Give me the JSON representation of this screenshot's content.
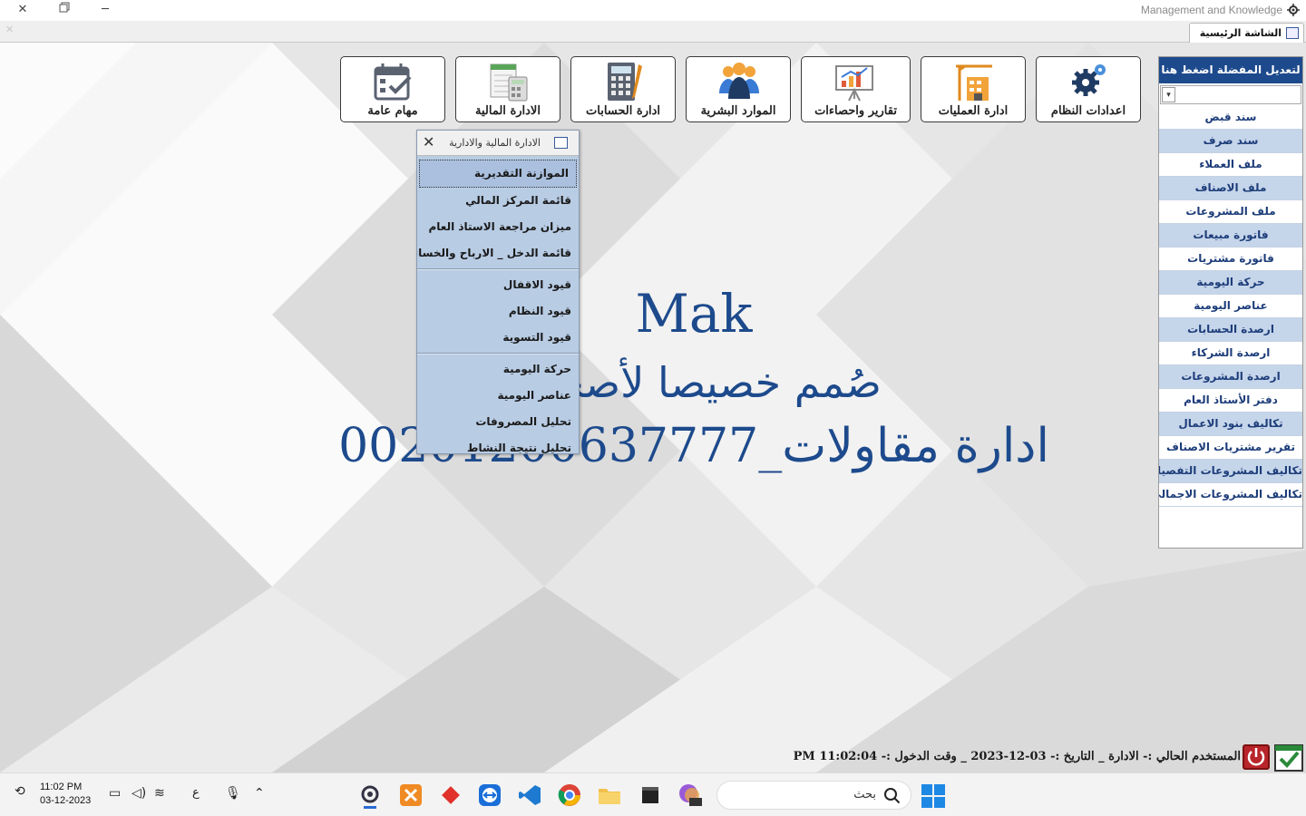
{
  "window": {
    "title": "Management and Knowledge",
    "controls": [
      "close-icon",
      "restore-icon",
      "minimize-icon"
    ]
  },
  "tab": {
    "label": "الشاشة الرئيسية"
  },
  "toolbar": [
    {
      "label": "اعدادات النظام",
      "icon": "gear-icon"
    },
    {
      "label": "ادارة العمليات",
      "icon": "crane-building-icon"
    },
    {
      "label": "تقارير واحصاءات",
      "icon": "presentation-chart-icon"
    },
    {
      "label": "الموارد البشرية",
      "icon": "people-icon"
    },
    {
      "label": "ادارة الحسابات",
      "icon": "calculator-icon"
    },
    {
      "label": "الادارة المالية",
      "icon": "ledger-calculator-icon"
    },
    {
      "label": "مهام عامة",
      "icon": "calendar-check-icon"
    }
  ],
  "favorites": {
    "header": "لتعديل المفضلة اضغط هنا",
    "items": [
      "سند قبض",
      "سند صرف",
      "ملف العملاء",
      "ملف الاصناف",
      "ملف المشروعات",
      "فاتورة مبيعات",
      "فاتورة مشتريات",
      "حركة اليومية",
      "عناصر اليومية",
      "ارصدة الحسابات",
      "ارصدة الشركاء",
      "ارصدة المشروعات",
      "دفتر الأستاذ العام",
      "تكاليف بنود الاعمال",
      "تقرير مشتريات الاصناف",
      "تكاليف المشروعات التفصيلي",
      "تكاليف المشروعات الاجمالي"
    ]
  },
  "center": {
    "line1": "Mak",
    "line2": "صُمم خصيصا لأصحاب",
    "line3": "ادارة مقاولات_00201200637777"
  },
  "popup": {
    "title": "الادارة المالية والادارية",
    "group1": [
      "الموازنة التقديرية",
      "قائمة المركز المالي",
      "ميزان مراجعة الاستاذ العام",
      "قائمة الدخل _ الارباح والخسائر"
    ],
    "group2": [
      "قيود الاقفال",
      "قيود النظام",
      "قيود التسوية"
    ],
    "group3": [
      "حركة اليومية",
      "عناصر اليومية",
      "تحليل المصروفات",
      "تحليل نتيجة النشاط"
    ]
  },
  "status": {
    "text": "المستخدم الحالي :- الادارة _ التاريخ :- 03-12-2023 _ وقت الدخول :- 11:02:04 PM"
  },
  "taskbar": {
    "time": "11:02 PM",
    "date": "03-12-2023",
    "lang": "ع",
    "search_placeholder": "بحث"
  },
  "colors": {
    "accent": "#1d4a8c",
    "favorites_alt_row": "#c5d5ea",
    "popup_bg": "#b8cce4",
    "power": "#b8252a"
  }
}
